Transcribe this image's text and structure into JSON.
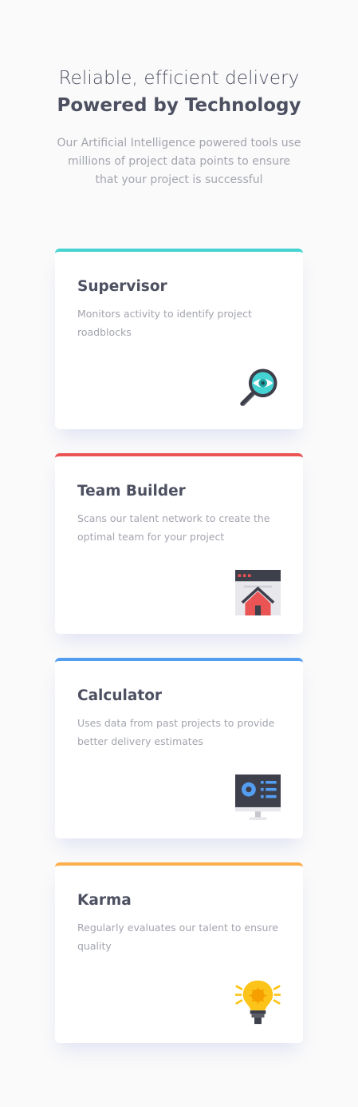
{
  "header": {
    "line1": "Reliable, efficient delivery",
    "line2": "Powered by Technology",
    "description": "Our Artificial Intelligence powered tools use millions of project data points to ensure that your project is successful"
  },
  "cards": [
    {
      "title": "Supervisor",
      "description": "Monitors activity to identify project roadblocks",
      "icon": "magnifier-eye-icon",
      "accent": "#44d3d2"
    },
    {
      "title": "Team Builder",
      "description": "Scans our talent network to create the optimal team for your project",
      "icon": "browser-house-icon",
      "accent": "#ea5454"
    },
    {
      "title": "Calculator",
      "description": "Uses data from past projects to provide better delivery estimates",
      "icon": "monitor-dashboard-icon",
      "accent": "#549ef2"
    },
    {
      "title": "Karma",
      "description": "Regularly evaluates our talent to ensure quality",
      "icon": "lightbulb-icon",
      "accent": "#fcae4a"
    }
  ],
  "colors": {
    "title": "#4d5061",
    "muted": "#a3a5ae",
    "background": "#fafafa"
  }
}
